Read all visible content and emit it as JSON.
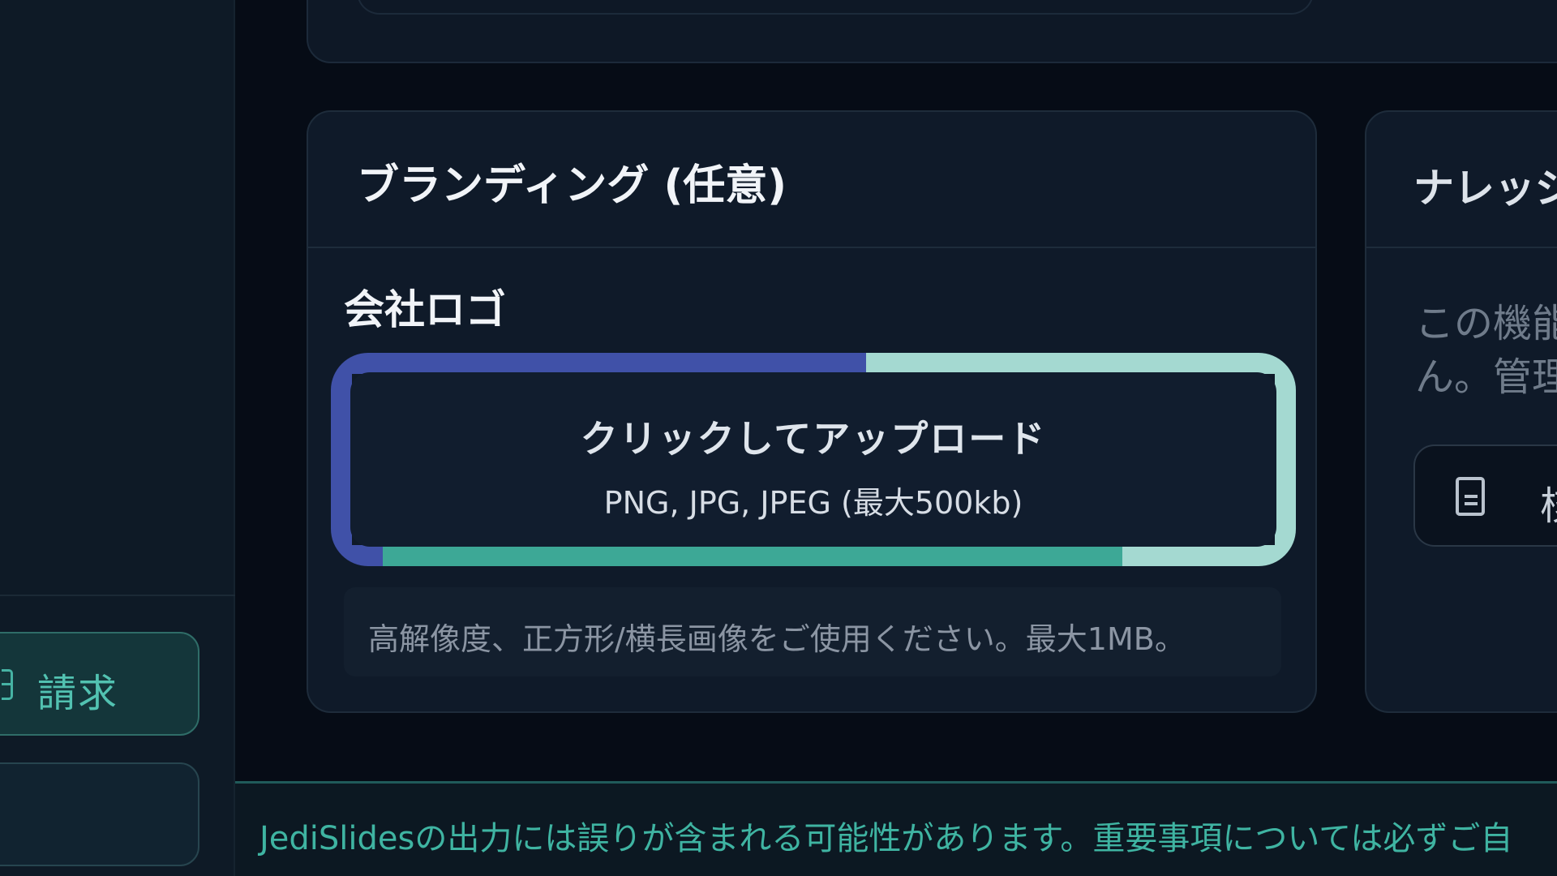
{
  "sidebar": {
    "items": [
      {
        "label": "請求",
        "icon": "billing-icon"
      },
      {
        "label": ""
      }
    ]
  },
  "branding_card": {
    "title": "ブランディング (任意)",
    "logo_label": "会社ロゴ",
    "upload_title": "クリックしてアップロード",
    "upload_hint": "PNG, JPG, JPEG (最大500kb)",
    "help_text": "高解像度、正方形/横長画像をご使用ください。最大1MB。"
  },
  "knowledge_card": {
    "title": "ナレッジ",
    "description_line1": "この機能",
    "description_line2": "ん。管理",
    "button_label": "核",
    "button_icon": "file-icon"
  },
  "footer": {
    "notice": "JediSlidesの出力には誤りが含まれる可能性があります。重要事項については必ずご自"
  },
  "colors": {
    "background": "#060c16",
    "card": "#0f1a29",
    "accent_teal": "#3da896",
    "accent_indigo": "#4051a8",
    "accent_mint": "#a4d9d1"
  }
}
